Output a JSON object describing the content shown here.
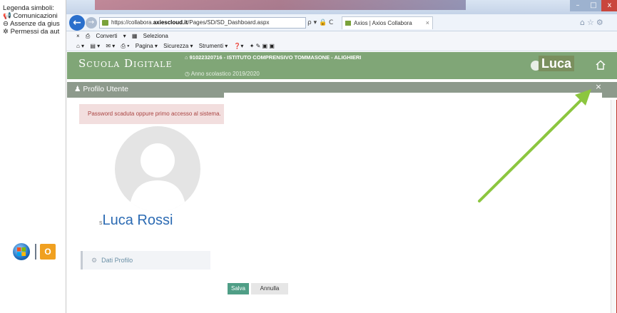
{
  "legend": {
    "title": "Legenda simboli:",
    "items": [
      "Comunicazioni",
      "Assenze da gius",
      "Permessi da aut"
    ]
  },
  "browser": {
    "url_prefix": "https://collabora.",
    "url_domain": "axiescloud.it",
    "url_path": "/Pages/SD/SD_Dashboard.aspx",
    "url_tools": "ρ ▾ 🔒 C",
    "tab_title": "Axios | Axios Collabora",
    "tab_close": "×",
    "favorites": [
      "Converti",
      "Seleziona"
    ],
    "commands": [
      "Pagina ▾",
      "Sicurezza ▾",
      "Strumenti ▾"
    ],
    "window_controls": {
      "minimize": "–",
      "maximize": "□",
      "close": "x"
    }
  },
  "app": {
    "brand": "Scuola Digitale",
    "school": "91022320716 - ISTITUTO COMPRENSIVO TOMMASONE - ALIGHIERI",
    "year": "Anno scolastico 2019/2020",
    "user": "Luca"
  },
  "panel": {
    "title": "Profilo Utente",
    "close": "×"
  },
  "alert": {
    "message": "Password scaduta oppure primo accesso al sistema."
  },
  "profile": {
    "name_prefix": "s",
    "name": "Luca Rossi"
  },
  "menu": {
    "dati_profilo": "Dati Profilo"
  },
  "buttons": {
    "save": "Salva",
    "cancel": "Annulla"
  },
  "taskbar": {
    "outlook": "O"
  },
  "colors": {
    "header_green": "#80a677",
    "panel_gray": "#8d9a8c",
    "alert_bg": "#f2dede",
    "alert_text": "#a94442",
    "name_blue": "#2c6bb3",
    "save_green": "#4f9e86",
    "annotation_arrow": "#8cc63f"
  }
}
